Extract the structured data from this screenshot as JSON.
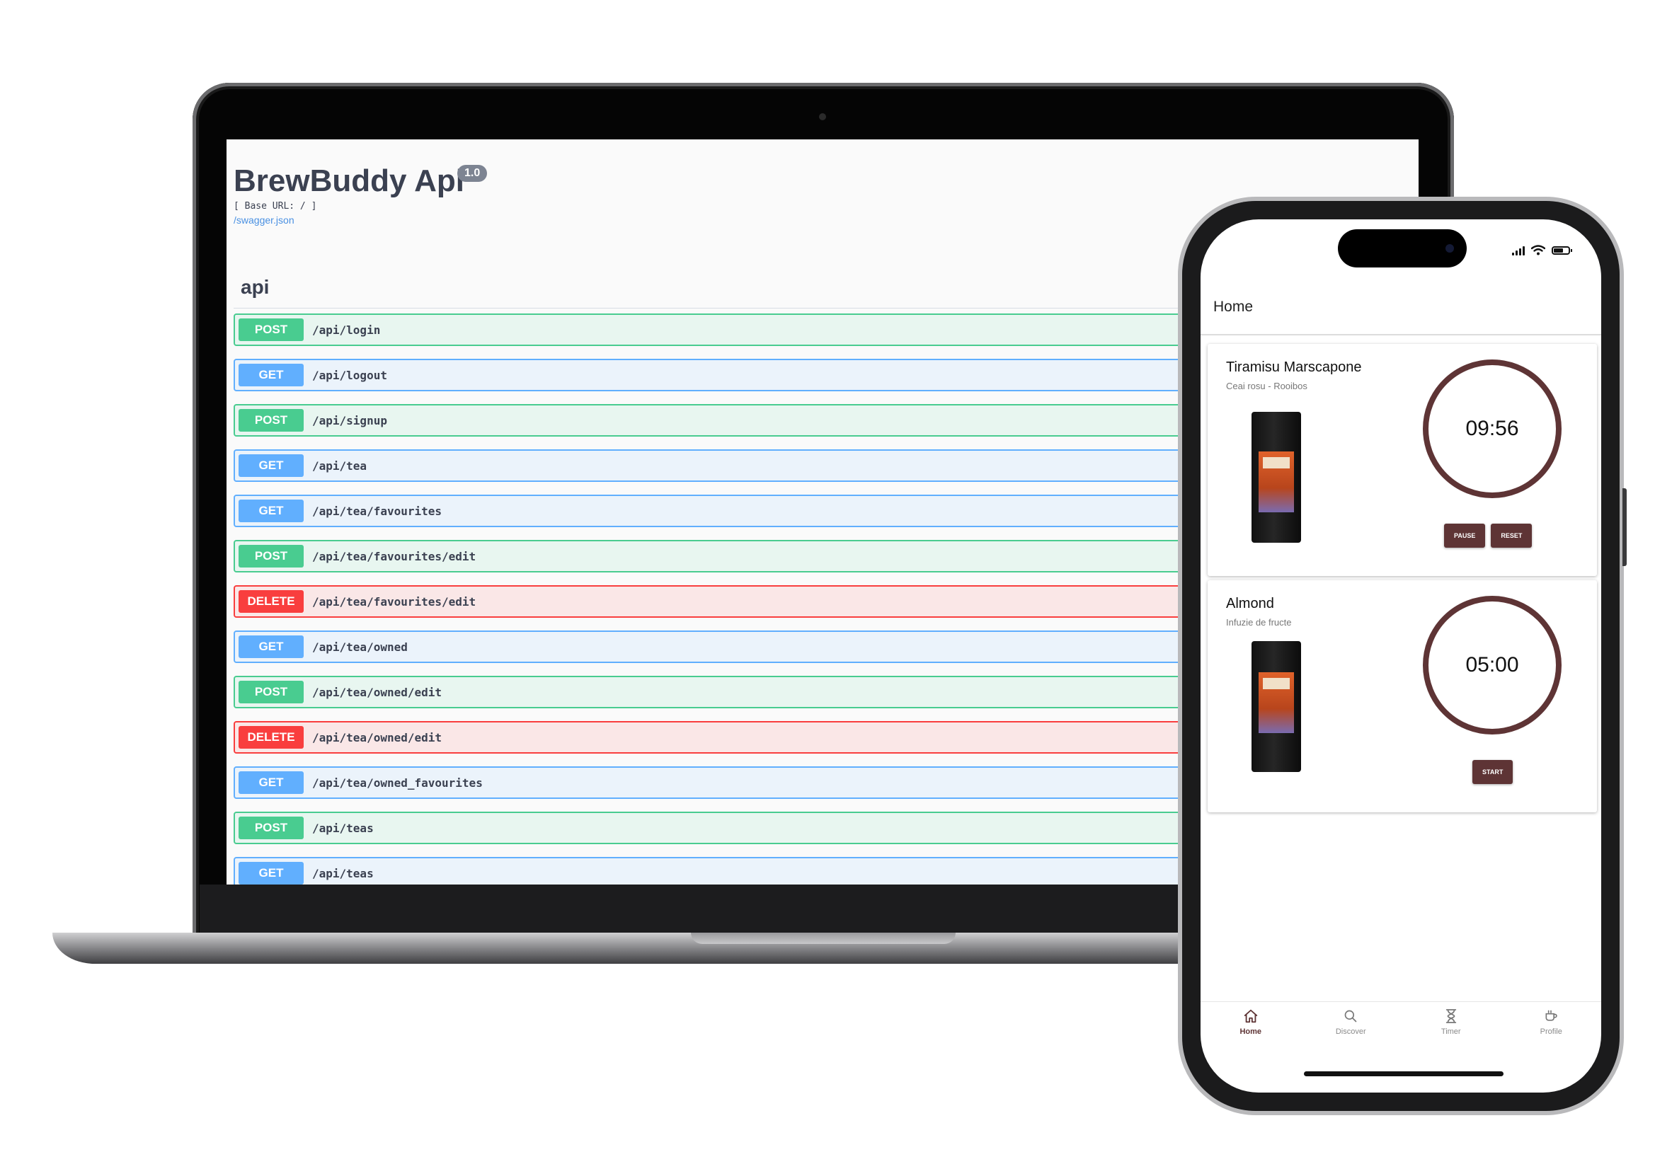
{
  "swagger": {
    "title": "BrewBuddy Api",
    "version": "1.0",
    "base_url": "[ Base URL: / ]",
    "spec_link": "/swagger.json",
    "section": "api",
    "operations": [
      {
        "method": "POST",
        "path": "/api/login"
      },
      {
        "method": "GET",
        "path": "/api/logout"
      },
      {
        "method": "POST",
        "path": "/api/signup"
      },
      {
        "method": "GET",
        "path": "/api/tea"
      },
      {
        "method": "GET",
        "path": "/api/tea/favourites"
      },
      {
        "method": "POST",
        "path": "/api/tea/favourites/edit"
      },
      {
        "method": "DELETE",
        "path": "/api/tea/favourites/edit"
      },
      {
        "method": "GET",
        "path": "/api/tea/owned"
      },
      {
        "method": "POST",
        "path": "/api/tea/owned/edit"
      },
      {
        "method": "DELETE",
        "path": "/api/tea/owned/edit"
      },
      {
        "method": "GET",
        "path": "/api/tea/owned_favourites"
      },
      {
        "method": "POST",
        "path": "/api/teas"
      },
      {
        "method": "GET",
        "path": "/api/teas"
      }
    ],
    "colors": {
      "post": "#49cc90",
      "get": "#61affe",
      "delete": "#f93e3e"
    }
  },
  "phone": {
    "app_title": "Home",
    "accent_color": "#5e3435",
    "status_icons": [
      "signal-icon",
      "wifi-icon",
      "battery-icon"
    ],
    "cards": [
      {
        "name": "Tiramisu Marscapone",
        "type": "Ceai rosu - Rooibos",
        "pack_label": "Tiramisu Marscapone",
        "timer": "09:56",
        "buttons": [
          "PAUSE",
          "RESET"
        ]
      },
      {
        "name": "Almond",
        "type": "Infuzie de fructe",
        "pack_label": "Almond",
        "timer": "05:00",
        "buttons": [
          "START"
        ]
      }
    ],
    "nav": [
      {
        "label": "Home",
        "icon": "home-icon",
        "active": true
      },
      {
        "label": "Discover",
        "icon": "search-icon",
        "active": false
      },
      {
        "label": "Timer",
        "icon": "hourglass-icon",
        "active": false
      },
      {
        "label": "Profile",
        "icon": "cup-icon",
        "active": false
      }
    ]
  }
}
